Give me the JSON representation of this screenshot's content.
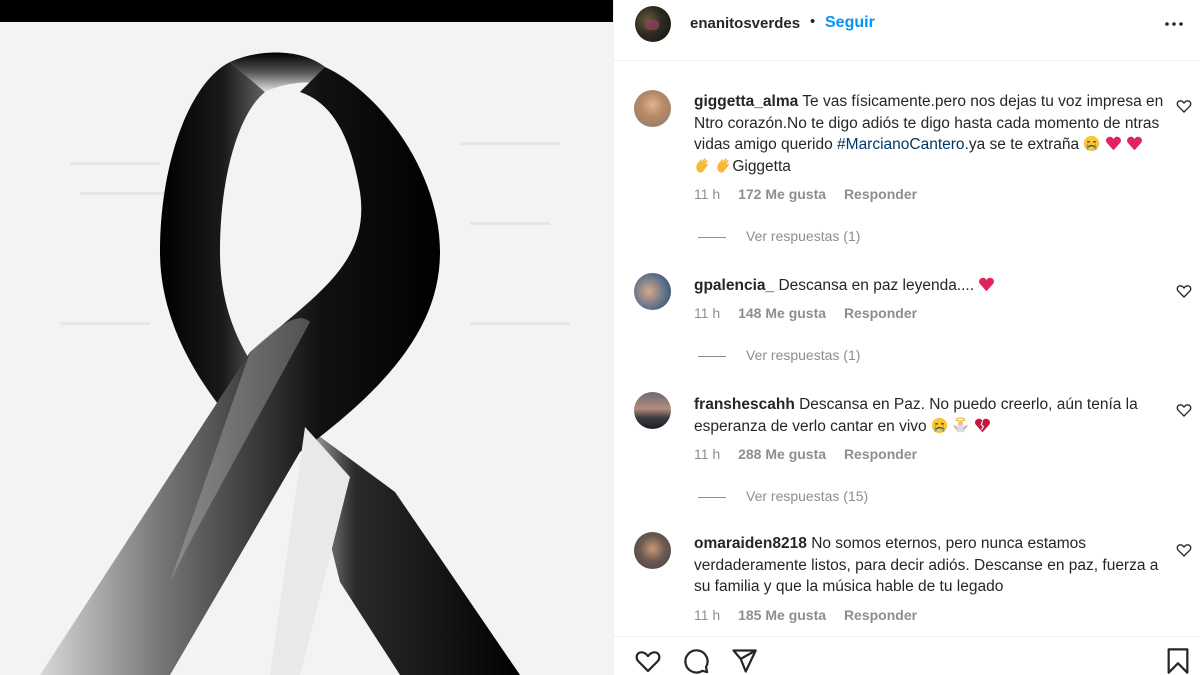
{
  "post": {
    "username": "enanitosverdes",
    "separator": "•",
    "follow_label": "Seguir"
  },
  "comments": [
    {
      "username": "giggetta_alma",
      "text_before": "Te vas físicamente.pero nos dejas tu voz impresa en Ntro corazón.No te digo adiós te digo hasta cada momento de ntras vidas amigo querido ",
      "hashtag": "#MarcianoCantero",
      "text_after": ".ya se te extraña",
      "text_end": "Giggetta",
      "time": "11 h",
      "likes": "172 Me gusta",
      "reply": "Responder",
      "view_replies": "Ver respuestas (1)"
    },
    {
      "username": "gpalencia_",
      "text": "Descansa en paz leyenda....",
      "time": "11 h",
      "likes": "148 Me gusta",
      "reply": "Responder",
      "view_replies": "Ver respuestas (1)"
    },
    {
      "username": "franshescahh",
      "text": "Descansa en Paz. No puedo creerlo, aún tenía la esperanza de verlo cantar en vivo",
      "time": "11 h",
      "likes": "288 Me gusta",
      "reply": "Responder",
      "view_replies": "Ver respuestas (15)"
    },
    {
      "username": "omaraiden8218",
      "text": "No somos eternos, pero nunca estamos verdaderamente listos, para decir adiós. Descanse en paz, fuerza a su familia y que la música hable de tu legado",
      "time": "11 h",
      "likes": "185 Me gusta",
      "reply": "Responder"
    }
  ],
  "icons": {
    "more": "more-options-icon",
    "like": "heart-icon",
    "comment": "comment-icon",
    "share": "share-icon",
    "save": "bookmark-icon"
  },
  "colors": {
    "link_blue": "#0095f6",
    "hashtag": "#00376b",
    "meta_gray": "#8e8e8e",
    "heart_red": "#e0245e"
  }
}
